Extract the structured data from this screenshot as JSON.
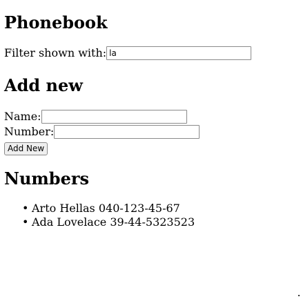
{
  "page": {
    "title": "Phonebook"
  },
  "filter": {
    "label": "Filter shown with:",
    "value": "la"
  },
  "add_new": {
    "heading": "Add new",
    "name_label": "Name:",
    "name_value": "",
    "number_label": "Number:",
    "number_value": "",
    "button_label": "Add New"
  },
  "numbers": {
    "heading": "Numbers",
    "entries": [
      {
        "text": "Arto Hellas 040-123-45-67"
      },
      {
        "text": "Ada Lovelace 39-44-5323523"
      }
    ]
  }
}
